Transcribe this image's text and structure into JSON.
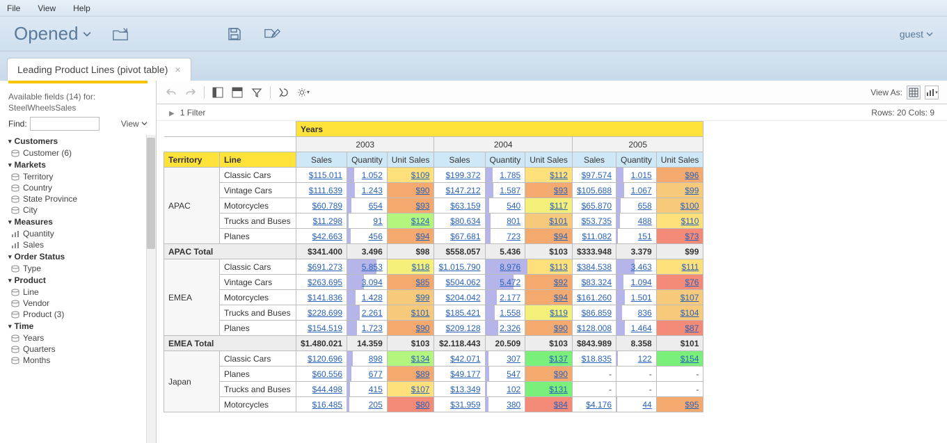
{
  "menubar": [
    "File",
    "View",
    "Help"
  ],
  "header": {
    "opened": "Opened",
    "user": "guest"
  },
  "tab": {
    "title": "Leading Product Lines (pivot table)"
  },
  "sidebar": {
    "available_label": "Available fields (14) for:",
    "datasource": "SteelWheelsSales",
    "find_label": "Find:",
    "view_label": "View",
    "groups": [
      {
        "name": "Customers",
        "fields": [
          {
            "label": "Customer (6)",
            "icon": "level"
          }
        ]
      },
      {
        "name": "Markets",
        "fields": [
          {
            "label": "Territory",
            "icon": "level"
          },
          {
            "label": "Country",
            "icon": "level"
          },
          {
            "label": "State Province",
            "icon": "level"
          },
          {
            "label": "City",
            "icon": "level"
          }
        ]
      },
      {
        "name": "Measures",
        "fields": [
          {
            "label": "Quantity",
            "icon": "measure"
          },
          {
            "label": "Sales",
            "icon": "measure"
          }
        ]
      },
      {
        "name": "Order Status",
        "fields": [
          {
            "label": "Type",
            "icon": "level"
          }
        ]
      },
      {
        "name": "Product",
        "fields": [
          {
            "label": "Line",
            "icon": "level"
          },
          {
            "label": "Vendor",
            "icon": "level"
          },
          {
            "label": "Product (3)",
            "icon": "level"
          }
        ]
      },
      {
        "name": "Time",
        "fields": [
          {
            "label": "Years",
            "icon": "level"
          },
          {
            "label": "Quarters",
            "icon": "level"
          },
          {
            "label": "Months",
            "icon": "level"
          }
        ]
      }
    ]
  },
  "main": {
    "viewas_label": "View As:",
    "filter_summary": "1 Filter",
    "rows_cols": "Rows: 20  Cols: 9",
    "headers": {
      "years": "Years",
      "territory": "Territory",
      "line": "Line",
      "year_list": [
        "2003",
        "2004",
        "2005"
      ],
      "measures": [
        "Sales",
        "Quantity",
        "Unit Sales"
      ]
    },
    "data": [
      {
        "territory": "APAC",
        "rows": [
          {
            "line": "Classic Cars",
            "v": [
              [
                "$115.011",
                "1.052",
                "$109"
              ],
              [
                "$199.372",
                "1.785",
                "$112"
              ],
              [
                "$97.574",
                "1.015",
                "$96"
              ]
            ],
            "qbar": [
              10,
              10,
              10
            ],
            "heat": [
              "h-gold",
              "h-gold",
              "h-dorange"
            ]
          },
          {
            "line": "Vintage Cars",
            "v": [
              [
                "$111.639",
                "1.243",
                "$90"
              ],
              [
                "$147.212",
                "1.587",
                "$93"
              ],
              [
                "$105.688",
                "1.067",
                "$99"
              ]
            ],
            "qbar": [
              11,
              11,
              11
            ],
            "heat": [
              "h-dorange",
              "h-dorange",
              "h-orange"
            ]
          },
          {
            "line": "Motorcycles",
            "v": [
              [
                "$60.789",
                "654",
                "$93"
              ],
              [
                "$63.159",
                "540",
                "$117"
              ],
              [
                "$65.870",
                "658",
                "$100"
              ]
            ],
            "qbar": [
              6,
              5,
              6
            ],
            "heat": [
              "h-dorange",
              "h-yellow",
              "h-orange"
            ]
          },
          {
            "line": "Trucks and Buses",
            "v": [
              [
                "$11.298",
                "91",
                "$124"
              ],
              [
                "$80.634",
                "801",
                "$101"
              ],
              [
                "$53.735",
                "488",
                "$110"
              ]
            ],
            "qbar": [
              2,
              7,
              5
            ],
            "heat": [
              "h-green2",
              "h-orange",
              "h-gold"
            ]
          },
          {
            "line": "Planes",
            "v": [
              [
                "$42.663",
                "456",
                "$94"
              ],
              [
                "$67.681",
                "723",
                "$94"
              ],
              [
                "$11.082",
                "151",
                "$73"
              ]
            ],
            "qbar": [
              5,
              7,
              2
            ],
            "heat": [
              "h-dorange",
              "h-dorange",
              "h-red"
            ]
          }
        ],
        "total": {
          "label": "APAC Total",
          "v": [
            [
              "$341.400",
              "3.496",
              "$98"
            ],
            [
              "$558.057",
              "5.436",
              "$103"
            ],
            [
              "$333.948",
              "3.379",
              "$99"
            ]
          ]
        }
      },
      {
        "territory": "EMEA",
        "rows": [
          {
            "line": "Classic Cars",
            "v": [
              [
                "$691.273",
                "5.853",
                "$118"
              ],
              [
                "$1.015.790",
                "8.976",
                "$113"
              ],
              [
                "$384.538",
                "3.463",
                "$111"
              ]
            ],
            "qbar": [
              42,
              60,
              26
            ],
            "heat": [
              "h-yellow",
              "h-gold",
              "h-gold"
            ]
          },
          {
            "line": "Vintage Cars",
            "v": [
              [
                "$263.695",
                "3.094",
                "$85"
              ],
              [
                "$504.062",
                "5.472",
                "$92"
              ],
              [
                "$83.324",
                "1.094",
                "$76"
              ]
            ],
            "qbar": [
              24,
              40,
              10
            ],
            "heat": [
              "h-dorange",
              "h-dorange",
              "h-red"
            ]
          },
          {
            "line": "Motorcycles",
            "v": [
              [
                "$141.836",
                "1.428",
                "$99"
              ],
              [
                "$204.042",
                "2.177",
                "$94"
              ],
              [
                "$161.260",
                "1.501",
                "$107"
              ]
            ],
            "qbar": [
              12,
              16,
              12
            ],
            "heat": [
              "h-orange",
              "h-dorange",
              "h-orange"
            ]
          },
          {
            "line": "Trucks and Buses",
            "v": [
              [
                "$228.699",
                "2.261",
                "$101"
              ],
              [
                "$185.421",
                "1.558",
                "$119"
              ],
              [
                "$86.859",
                "836",
                "$104"
              ]
            ],
            "qbar": [
              18,
              13,
              8
            ],
            "heat": [
              "h-orange",
              "h-yellow",
              "h-orange"
            ]
          },
          {
            "line": "Planes",
            "v": [
              [
                "$154.519",
                "1.723",
                "$90"
              ],
              [
                "$209.128",
                "2.326",
                "$90"
              ],
              [
                "$128.008",
                "1.464",
                "$87"
              ]
            ],
            "qbar": [
              14,
              18,
              12
            ],
            "heat": [
              "h-dorange",
              "h-dorange",
              "h-red"
            ]
          }
        ],
        "total": {
          "label": "EMEA Total",
          "v": [
            [
              "$1.480.021",
              "14.359",
              "$103"
            ],
            [
              "$2.118.443",
              "20.509",
              "$103"
            ],
            [
              "$843.989",
              "8.358",
              "$101"
            ]
          ]
        }
      },
      {
        "territory": "Japan",
        "rows": [
          {
            "line": "Classic Cars",
            "v": [
              [
                "$120.696",
                "898",
                "$134"
              ],
              [
                "$42.071",
                "307",
                "$137"
              ],
              [
                "$18.835",
                "122",
                "$154"
              ]
            ],
            "qbar": [
              8,
              4,
              2
            ],
            "heat": [
              "h-green2",
              "h-green1",
              "h-green1"
            ]
          },
          {
            "line": "Planes",
            "v": [
              [
                "$60.556",
                "677",
                "$89"
              ],
              [
                "$49.177",
                "547",
                "$90"
              ],
              [
                "-",
                "-",
                "-"
              ]
            ],
            "qbar": [
              6,
              5,
              0
            ],
            "heat": [
              "h-dorange",
              "h-dorange",
              ""
            ]
          },
          {
            "line": "Trucks and Buses",
            "v": [
              [
                "$44.498",
                "415",
                "$107"
              ],
              [
                "$13.349",
                "102",
                "$131"
              ],
              [
                "-",
                "-",
                "-"
              ]
            ],
            "qbar": [
              4,
              2,
              0
            ],
            "heat": [
              "h-gold",
              "h-green1",
              ""
            ]
          },
          {
            "line": "Motorcycles",
            "v": [
              [
                "$16.485",
                "205",
                "$80"
              ],
              [
                "$31.959",
                "380",
                "$84"
              ],
              [
                "$4.176",
                "44",
                "$95"
              ]
            ],
            "qbar": [
              3,
              4,
              1
            ],
            "heat": [
              "h-red",
              "h-red",
              "h-dorange"
            ]
          }
        ]
      }
    ]
  }
}
